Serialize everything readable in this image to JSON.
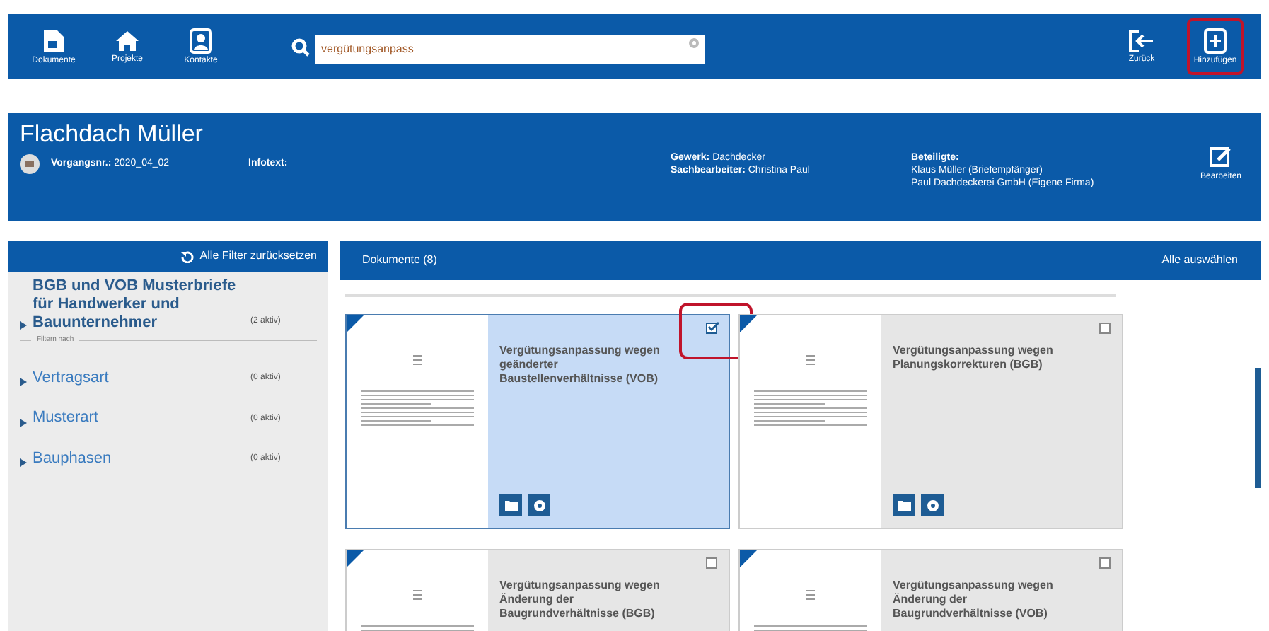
{
  "toolbar": {
    "left": [
      {
        "label": "Dokumente"
      },
      {
        "label": "Projekte"
      },
      {
        "label": "Kontakte"
      }
    ],
    "search": {
      "value": "vergütungsanpass"
    },
    "right": [
      {
        "label": "Zurück",
        "highlighted": false
      },
      {
        "label": "Hinzufügen",
        "highlighted": true
      }
    ]
  },
  "project": {
    "title": "Flachdach Müller",
    "fields": [
      {
        "label": "Vorgangsnr.:",
        "value": "2020_04_02"
      },
      {
        "label": "Infotext:"
      }
    ],
    "gewerk": {
      "label": "Gewerk:",
      "value": "Dachdecker"
    },
    "sachbearbeiter": {
      "label": "Sachbearbeiter:",
      "value": "Christina Paul"
    },
    "beteiligte": {
      "label": "Beteiligte:",
      "values": [
        "Klaus Müller (Briefempfänger)",
        "Paul Dachdeckerei GmbH (Eigene Firma)"
      ]
    },
    "edit_label": "Bearbeiten"
  },
  "filters": {
    "reset": "Alle Filter zurücksetzen",
    "items": [
      {
        "kind": "group",
        "label": "BGB und VOB Musterbriefe für Handwerker und Bauunternehmer",
        "count": "(2 aktiv)"
      },
      {
        "kind": "divider",
        "label": "Filtern nach"
      },
      {
        "kind": "filter",
        "label": "Vertragsart",
        "count": "(0 aktiv)"
      },
      {
        "kind": "filter",
        "label": "Musterart",
        "count": "(0 aktiv)"
      },
      {
        "kind": "filter",
        "label": "Bauphasen",
        "count": "(0 aktiv)"
      }
    ]
  },
  "documents": {
    "title": "Dokumente (8)",
    "select_all": "Alle auswählen",
    "cards": [
      {
        "title": "Vergütungsanpassung wegen geänderter Baustellenverhältnisse (VOB)",
        "selected": true,
        "checked": true,
        "highlighted": true
      },
      {
        "title": "Vergütungsanpassung wegen Planungskorrekturen (BGB)",
        "selected": false,
        "checked": false,
        "highlighted": false
      },
      {
        "title": "Vergütungsanpassung wegen Änderung der Baugrundverhältnisse (BGB)",
        "selected": false,
        "checked": false,
        "highlighted": false
      },
      {
        "title": "Vergütungsanpassung wegen Änderung der Baugrundverhältnisse (VOB)",
        "selected": false,
        "checked": false,
        "highlighted": false
      }
    ]
  }
}
